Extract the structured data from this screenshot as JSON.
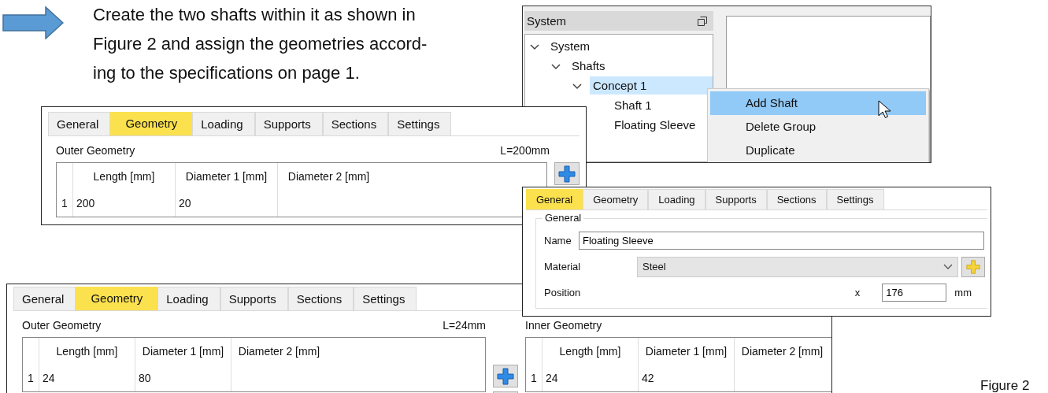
{
  "instruction": {
    "text": "Create the two shafts within it as shown in\nFigure 2 and assign the geometries accord-\ning to the specifications on page 1."
  },
  "system_window": {
    "panel_title": "System",
    "tree": [
      {
        "label": "System",
        "expanded": true,
        "selected": false,
        "children": [
          {
            "label": "Shafts",
            "expanded": true,
            "selected": false,
            "children": [
              {
                "label": "Concept 1",
                "expanded": true,
                "selected": true,
                "children": [
                  {
                    "label": "Shaft 1",
                    "selected": false
                  },
                  {
                    "label": "Floating Sleeve",
                    "selected": false
                  }
                ]
              }
            ]
          }
        ]
      }
    ],
    "context_menu": [
      {
        "label": "Add Shaft",
        "selected": true
      },
      {
        "label": "Delete Group",
        "selected": false
      },
      {
        "label": "Duplicate",
        "selected": false
      }
    ]
  },
  "shaft_window": {
    "tabs": [
      {
        "label": "General",
        "selected": false
      },
      {
        "label": "Geometry",
        "selected": true
      },
      {
        "label": "Loading",
        "selected": false
      },
      {
        "label": "Supports",
        "selected": false
      },
      {
        "label": "Sections",
        "selected": false
      },
      {
        "label": "Settings",
        "selected": false
      }
    ],
    "outer_geometry": {
      "title": "Outer Geometry",
      "total_length": "L=200mm",
      "columns": [
        "Length [mm]",
        "Diameter 1 [mm]",
        "Diameter 2 [mm]"
      ],
      "rows": [
        {
          "number": "1",
          "length": "200",
          "diameter_1": "20"
        }
      ]
    }
  },
  "sleeve_geometry_window": {
    "tabs": [
      {
        "label": "General",
        "selected": false
      },
      {
        "label": "Geometry",
        "selected": true
      },
      {
        "label": "Loading",
        "selected": false
      },
      {
        "label": "Supports",
        "selected": false
      },
      {
        "label": "Sections",
        "selected": false
      },
      {
        "label": "Settings",
        "selected": false
      }
    ],
    "outer_geometry": {
      "title": "Outer Geometry",
      "total_length": "L=24mm",
      "columns": [
        "Length [mm]",
        "Diameter 1 [mm]",
        "Diameter 2 [mm]"
      ],
      "rows": [
        {
          "number": "1",
          "length": "24",
          "diameter_1": "80"
        }
      ]
    },
    "inner_geometry": {
      "title": "Inner Geometry",
      "columns": [
        "Length [mm]",
        "Diameter 1 [mm]",
        "Diameter 2 [mm]"
      ],
      "rows": [
        {
          "number": "1",
          "length": "24",
          "diameter_1": "42"
        }
      ]
    }
  },
  "sleeve_window": {
    "tabs": [
      {
        "label": "General",
        "selected": true
      },
      {
        "label": "Geometry",
        "selected": false
      },
      {
        "label": "Loading",
        "selected": false
      },
      {
        "label": "Supports",
        "selected": false
      },
      {
        "label": "Sections",
        "selected": false
      },
      {
        "label": "Settings",
        "selected": false
      }
    ],
    "group_title": "General",
    "name_label": "Name",
    "name_value": "Floating Sleeve",
    "material_label": "Material",
    "material_value": "Steel",
    "position_label": "Position",
    "position_axis": "x",
    "position_value": "176",
    "position_unit": "mm"
  },
  "caption": "Figure 2"
}
